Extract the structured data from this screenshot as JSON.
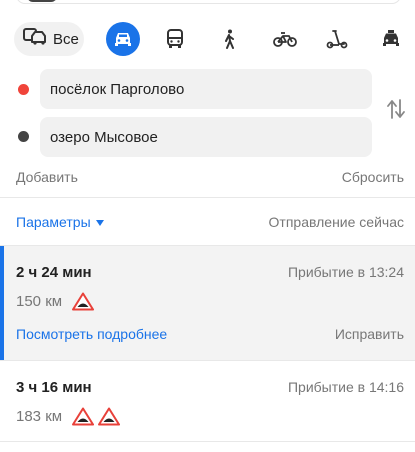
{
  "modes": {
    "all_label": "Все",
    "items": [
      {
        "icon": "car-icon",
        "active": true
      },
      {
        "icon": "bus-icon",
        "active": false
      },
      {
        "icon": "pedestrian-icon",
        "active": false
      },
      {
        "icon": "bicycle-icon",
        "active": false
      },
      {
        "icon": "scooter-icon",
        "active": false
      },
      {
        "icon": "taxi-icon",
        "active": false
      }
    ],
    "accent": "#1a73e8"
  },
  "route": {
    "from": "посёлок Парголово",
    "to": "озеро Мысовое",
    "from_color": "#f0443a",
    "to_color": "#444444",
    "add_label": "Добавить",
    "reset_label": "Сбросить"
  },
  "options": {
    "params_label": "Параметры",
    "departure_label": "Отправление сейчас"
  },
  "results": [
    {
      "duration": "2 ч 24 мин",
      "arrival": "Прибытие в 13:24",
      "distance": "150 км",
      "bumps": 1,
      "selected": true,
      "details_label": "Посмотреть подробнее",
      "fix_label": "Исправить"
    },
    {
      "duration": "3 ч 16 мин",
      "arrival": "Прибытие в 14:16",
      "distance": "183 км",
      "bumps": 2,
      "selected": false
    }
  ],
  "colors": {
    "warning_red": "#e8413a"
  }
}
